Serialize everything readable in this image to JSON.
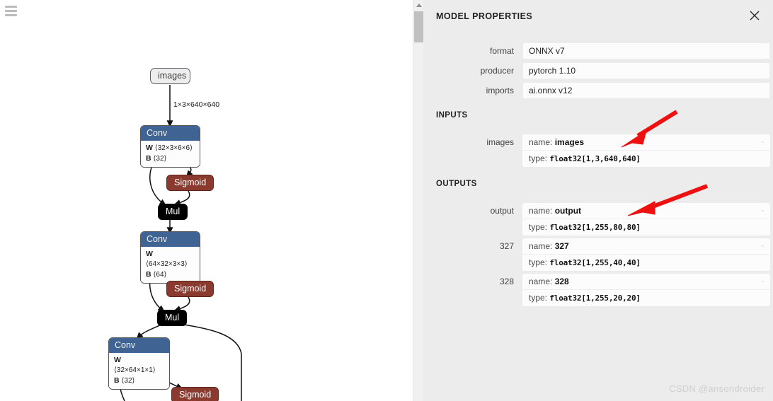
{
  "app": {
    "menu_icon": "hamburger-icon",
    "watermark": "CSDN @ansondroider"
  },
  "properties_panel": {
    "title": "MODEL PROPERTIES",
    "close_icon": "close-icon",
    "model_rows": [
      {
        "label": "format",
        "value": "ONNX v7"
      },
      {
        "label": "producer",
        "value": "pytorch 1.10"
      },
      {
        "label": "imports",
        "value": "ai.onnx v12"
      }
    ],
    "inputs_heading": "INPUTS",
    "inputs": [
      {
        "label": "images",
        "name_key": "name:",
        "name_value": "images",
        "type_key": "type:",
        "type_value": "float32[1,3,640,640]",
        "collapse": "-"
      }
    ],
    "outputs_heading": "OUTPUTS",
    "outputs": [
      {
        "label": "output",
        "name_key": "name:",
        "name_value": "output",
        "type_key": "type:",
        "type_value": "float32[1,255,80,80]",
        "collapse": "-"
      },
      {
        "label": "327",
        "name_key": "name:",
        "name_value": "327",
        "type_key": "type:",
        "type_value": "float32[1,255,40,40]",
        "collapse": "-"
      },
      {
        "label": "328",
        "name_key": "name:",
        "name_value": "328",
        "type_key": "type:",
        "type_value": "float32[1,255,20,20]",
        "collapse": "-"
      }
    ]
  },
  "graph": {
    "input_node": "images",
    "edge_label_top": "1×3×640×640",
    "nodes": [
      {
        "id": "conv1",
        "title": "Conv",
        "w_key": "W",
        "w_value": "⟨32×3×6×6⟩",
        "b_key": "B",
        "b_value": "⟨32⟩"
      },
      {
        "id": "sigmoid1",
        "title": "Sigmoid"
      },
      {
        "id": "mul1",
        "title": "Mul"
      },
      {
        "id": "conv2",
        "title": "Conv",
        "w_key": "W",
        "w_value": "⟨64×32×3×3⟩",
        "b_key": "B",
        "b_value": "⟨64⟩"
      },
      {
        "id": "sigmoid2",
        "title": "Sigmoid"
      },
      {
        "id": "mul2",
        "title": "Mul"
      },
      {
        "id": "conv3",
        "title": "Conv",
        "w_key": "W",
        "w_value": "⟨32×64×1×1⟩",
        "b_key": "B",
        "b_value": "⟨32⟩"
      },
      {
        "id": "sigmoid3",
        "title": "Sigmoid"
      }
    ]
  },
  "scrollbar": {
    "up_arrow_icon": "caret-up-icon"
  },
  "colors": {
    "conv_header": "#3f6493",
    "sigmoid": "#8b3a2f",
    "mul": "#000000",
    "panel_bg": "#ececec",
    "annotation_red": "#ee1111"
  }
}
